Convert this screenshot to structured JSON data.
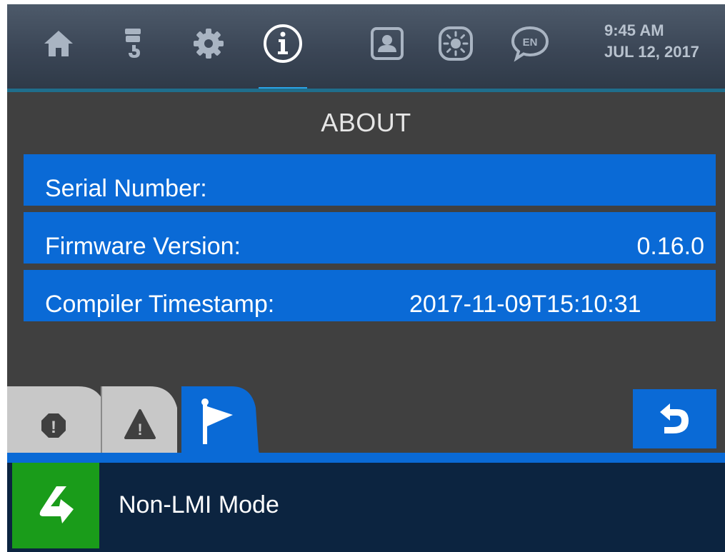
{
  "topbar": {
    "icons": [
      "home-icon",
      "crane-hook-icon",
      "gear-icon",
      "info-icon",
      "operator-icon",
      "brightness-icon",
      "language-icon"
    ],
    "active": "info-icon",
    "language_code": "EN",
    "info_glyph": "i",
    "time": "9:45 AM",
    "date": "JUL 12, 2017"
  },
  "page": {
    "title": "ABOUT",
    "rows": [
      {
        "label": "Serial Number:",
        "value": ""
      },
      {
        "label": "Firmware Version:",
        "value": "0.16.0"
      },
      {
        "label": "Compiler Timestamp:",
        "value": "2017-11-09T15:10:31"
      }
    ]
  },
  "tabs": {
    "items": [
      "error-icon",
      "warning-icon",
      "flag-icon"
    ],
    "active": "flag-icon",
    "error_glyph": "!",
    "warning_glyph": "!"
  },
  "status": {
    "mode_label": "Non-LMI Mode"
  },
  "colors": {
    "accent_blue": "#0a6ad6",
    "active_indicator": "#2aa3e6",
    "background": "#404040",
    "status_bar": "#0c2440",
    "mode_green": "#1a9c1a",
    "inactive_tab": "#c8c8c8",
    "icon_gray": "#a9b4c2"
  }
}
